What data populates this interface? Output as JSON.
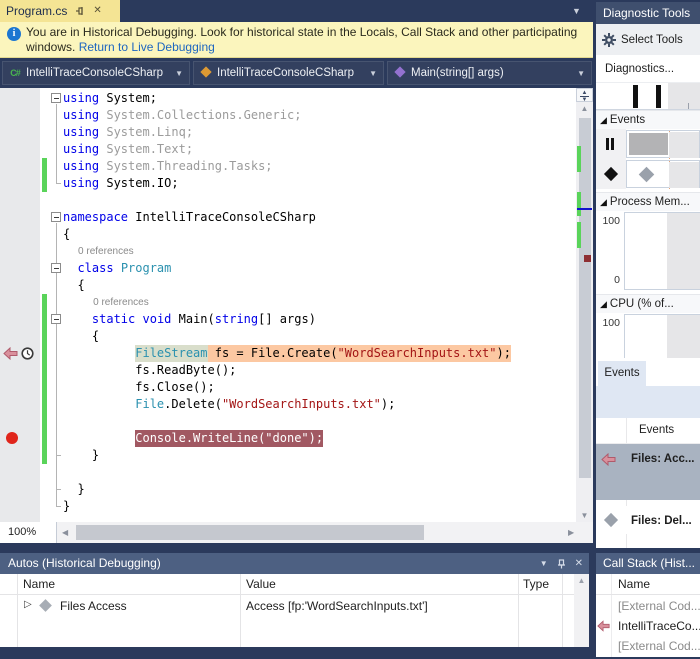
{
  "tab": {
    "title": "Program.cs"
  },
  "infobar": {
    "message": "You are in Historical Debugging. Look for historical state in the Locals, Call Stack and other participating windows.",
    "link_label": "Return to Live Debugging"
  },
  "navbar": {
    "project": "IntelliTraceConsoleCSharp",
    "type": "IntelliTraceConsoleCSharp",
    "member": "Main(string[] args)",
    "project_icon": "C#"
  },
  "editor": {
    "zoom_level": "100%",
    "codelens_label": "0 references",
    "event_line": 15,
    "breakpoint_line": 20,
    "fold_regions": [
      [
        0,
        5
      ],
      [
        7,
        24
      ],
      [
        10,
        23
      ],
      [
        13,
        21
      ]
    ],
    "change_bars": [
      [
        4,
        6
      ],
      [
        12,
        22
      ]
    ],
    "lines": [
      {
        "t": "code",
        "seg": [
          [
            "k",
            "using"
          ],
          [
            "p",
            " System;"
          ]
        ]
      },
      {
        "t": "code",
        "seg": [
          [
            "k",
            "using"
          ],
          [
            "g",
            " System.Collections.Generic;"
          ]
        ]
      },
      {
        "t": "code",
        "seg": [
          [
            "k",
            "using"
          ],
          [
            "g",
            " System.Linq;"
          ]
        ]
      },
      {
        "t": "code",
        "seg": [
          [
            "k",
            "using"
          ],
          [
            "g",
            " System.Text;"
          ]
        ]
      },
      {
        "t": "code",
        "seg": [
          [
            "k",
            "using"
          ],
          [
            "g",
            " System.Threading.Tasks;"
          ]
        ]
      },
      {
        "t": "code",
        "seg": [
          [
            "k",
            "using"
          ],
          [
            "p",
            " System.IO;"
          ]
        ]
      },
      {
        "t": "blank"
      },
      {
        "t": "code",
        "seg": [
          [
            "k",
            "namespace"
          ],
          [
            "p",
            " IntelliTraceConsoleCSharp"
          ]
        ]
      },
      {
        "t": "code",
        "seg": [
          [
            "p",
            "{"
          ]
        ]
      },
      {
        "t": "lens",
        "indent": 2
      },
      {
        "t": "code",
        "seg": [
          [
            "p",
            "  "
          ],
          [
            "k",
            "class"
          ],
          [
            "p",
            " "
          ],
          [
            "ty",
            "Program"
          ]
        ]
      },
      {
        "t": "code",
        "seg": [
          [
            "p",
            "  {"
          ]
        ]
      },
      {
        "t": "lens",
        "indent": 4
      },
      {
        "t": "code",
        "seg": [
          [
            "p",
            "    "
          ],
          [
            "k",
            "static"
          ],
          [
            "p",
            " "
          ],
          [
            "k",
            "void"
          ],
          [
            "p",
            " Main("
          ],
          [
            "k",
            "string"
          ],
          [
            "p",
            "[] args)"
          ]
        ]
      },
      {
        "t": "code",
        "seg": [
          [
            "p",
            "    {"
          ]
        ]
      },
      {
        "t": "code",
        "seg": [
          [
            "p",
            "          "
          ],
          [
            "ty evg",
            "FileStream"
          ],
          [
            "p evo",
            " fs = File.Create("
          ],
          [
            "s evo",
            "\"WordSearchInputs.txt\""
          ],
          [
            "p evo",
            ");"
          ]
        ]
      },
      {
        "t": "code",
        "seg": [
          [
            "p",
            "          fs.ReadByte();"
          ]
        ]
      },
      {
        "t": "code",
        "seg": [
          [
            "p",
            "          fs.Close();"
          ]
        ]
      },
      {
        "t": "code",
        "seg": [
          [
            "p",
            "          "
          ],
          [
            "ty",
            "File"
          ],
          [
            "p",
            ".Delete("
          ],
          [
            "s",
            "\"WordSearchInputs.txt\""
          ],
          [
            "p",
            ");"
          ]
        ]
      },
      {
        "t": "blank"
      },
      {
        "t": "code",
        "seg": [
          [
            "p",
            "          "
          ],
          [
            "bp",
            "Console.WriteLine(\"done\");"
          ]
        ]
      },
      {
        "t": "code",
        "seg": [
          [
            "p",
            "    }"
          ]
        ]
      },
      {
        "t": "blank"
      },
      {
        "t": "code",
        "seg": [
          [
            "p",
            "  }"
          ]
        ]
      },
      {
        "t": "code",
        "seg": [
          [
            "p",
            "}"
          ]
        ]
      }
    ]
  },
  "autos": {
    "title": "Autos (Historical Debugging)",
    "columns": [
      "Name",
      "Value",
      "Type"
    ],
    "rows": [
      {
        "name": "Files Access",
        "value": "Access [fp:'WordSearchInputs.txt']",
        "type": ""
      }
    ]
  },
  "callstack": {
    "title": "Call Stack (Hist...",
    "name_column": "Name",
    "frames": [
      {
        "label": "[External Cod..."
      },
      {
        "label": "IntelliTraceCo..."
      },
      {
        "label": "[External Cod..."
      }
    ]
  },
  "diagnostics": {
    "title": "Diagnostic Tools",
    "select_tools_label": "Select Tools",
    "session_label": "Diagnostics...",
    "sections": {
      "events": "Events",
      "memory": "Process Mem...",
      "cpu": "CPU (% of..."
    },
    "memory_axis": {
      "max": "100",
      "min": "0"
    },
    "cpu_axis": {
      "max": "100"
    },
    "tab_label": "Events",
    "grid_header": "Events",
    "event_rows": [
      {
        "label": "Files: Acc..."
      },
      {
        "label": "Files: Del..."
      }
    ]
  },
  "colors": {
    "event_highlight": "#fcc8a2",
    "event_token_highlight": "#d9decb",
    "breakpoint_line": "#a15862",
    "breakpoint_dot": "#e0251b",
    "change_bar": "#5ad45a",
    "link": "#1e66c0",
    "panel_title": "#4d6082",
    "tab_active": "#f4e494"
  }
}
